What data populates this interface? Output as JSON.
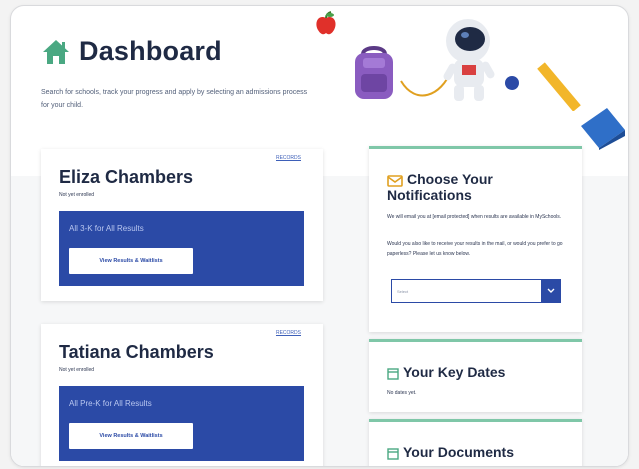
{
  "page": {
    "title": "Dashboard",
    "subtitle": "Search for schools, track your progress and apply by selecting an admissions process for your child."
  },
  "students": [
    {
      "name": "Eliza Chambers",
      "status": "Not yet enrolled",
      "link": "RECORDS",
      "panel_title": "All 3-K for All Results",
      "button": "View Results & Waitlists"
    },
    {
      "name": "Tatiana Chambers",
      "status": "Not yet enrolled",
      "link": "RECORDS",
      "panel_title": "All Pre-K for All Results",
      "button": "View Results & Waitlists"
    }
  ],
  "notifications": {
    "title_line1": "Choose Your",
    "title_line2": "Notifications",
    "text1": "We will email you at [email protected] when results are available in MySchools.",
    "text2": "Would you also like to receive your results in the mail, or would you prefer to go paperless? Please let us know below.",
    "select_value": "Select"
  },
  "key_dates": {
    "title": "Your Key Dates",
    "text": "No dates yet."
  },
  "documents": {
    "title": "Your Documents"
  },
  "colors": {
    "primary_blue": "#2b4aa6",
    "accent_green": "#7fc7a8",
    "home_icon": "#4aa882",
    "title": "#1f2a44"
  },
  "icons": [
    "home-icon",
    "envelope-icon",
    "calendar-icon",
    "chevron-down-icon",
    "apple-icon",
    "backpack-icon",
    "astronaut-icon",
    "ruler-icon",
    "book-icon"
  ]
}
